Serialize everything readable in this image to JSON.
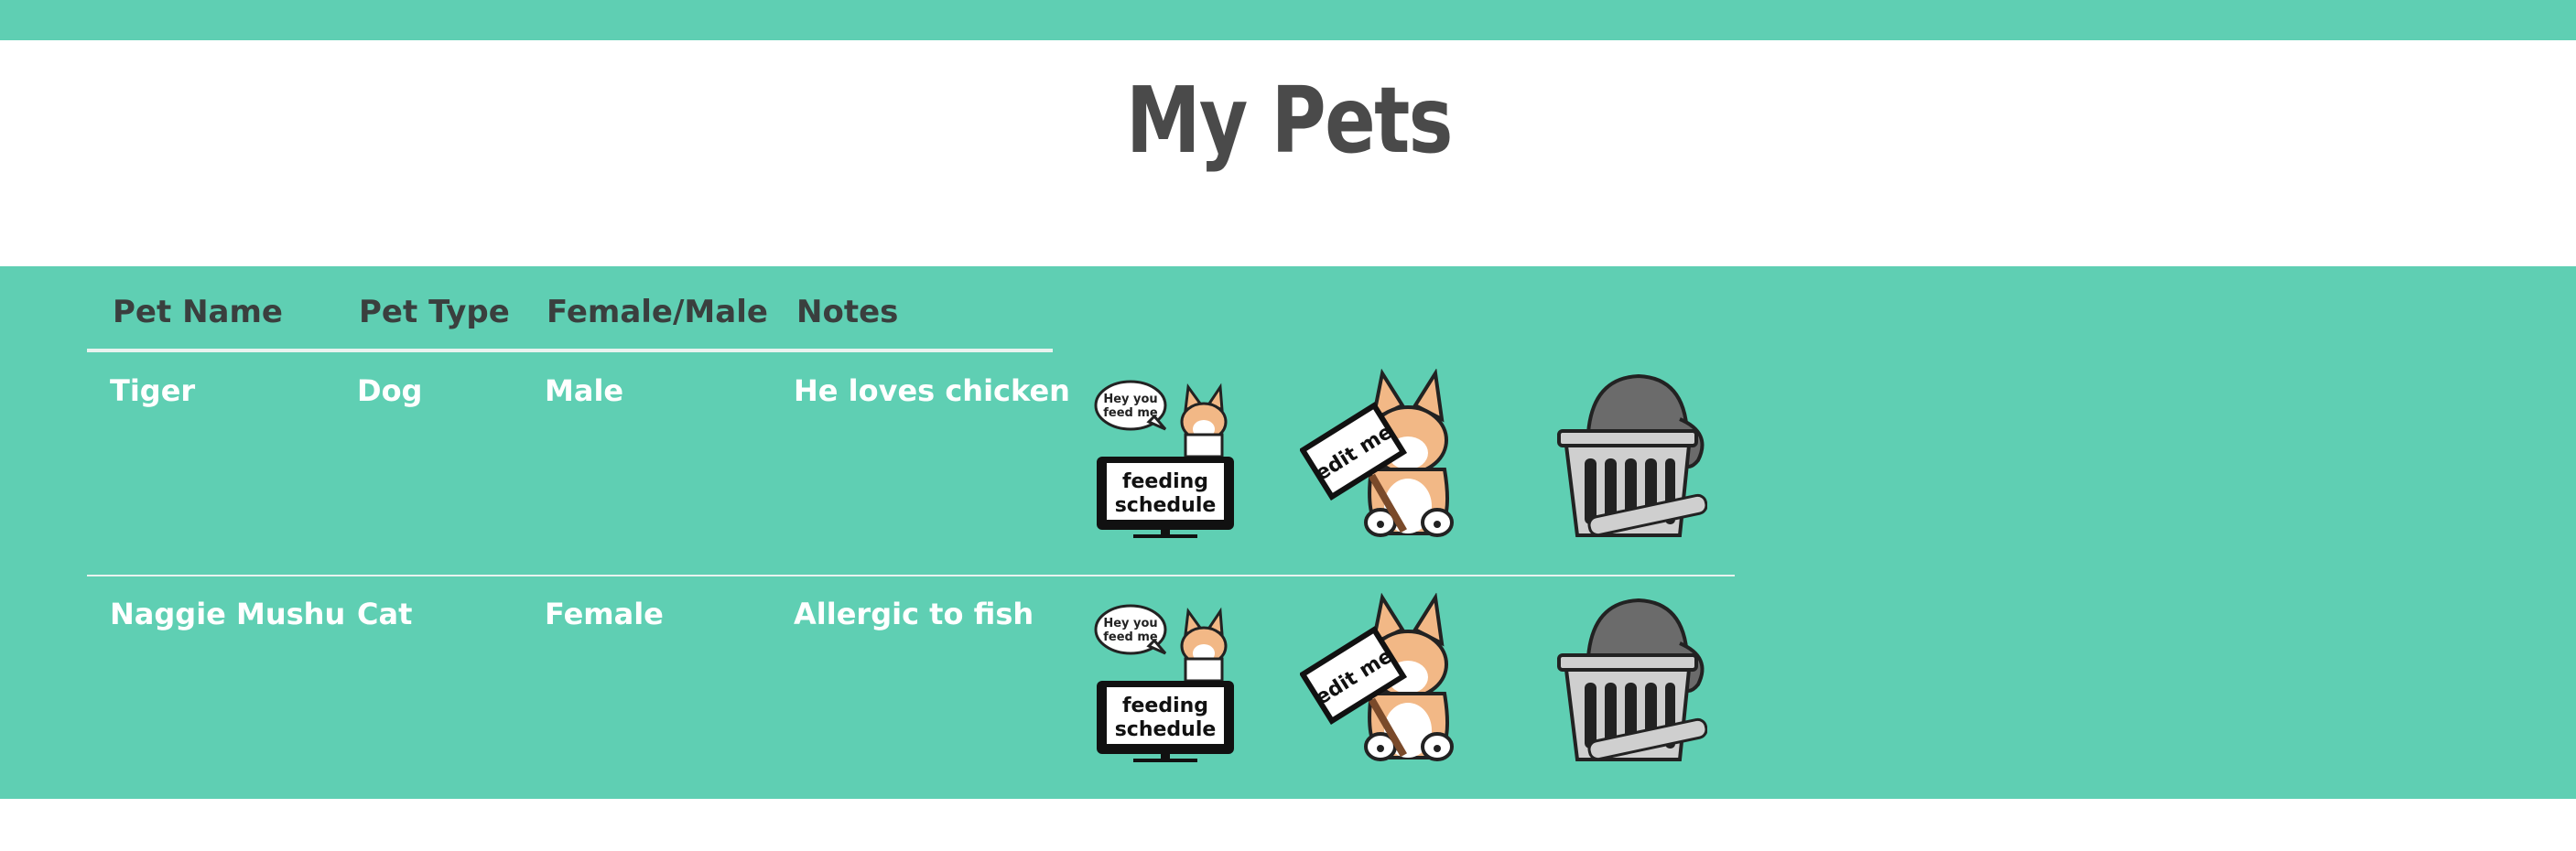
{
  "colors": {
    "accent": "#5fcfb3",
    "title": "#4a4a4a",
    "header_text": "#3a3f3e",
    "cell_text": "#ffffff"
  },
  "page": {
    "title": "My Pets"
  },
  "table": {
    "headers": [
      "Pet Name",
      "Pet Type",
      "Female/Male",
      "Notes"
    ],
    "rows": [
      {
        "name": "Tiger",
        "type": "Dog",
        "sex": "Male",
        "notes": "He loves chicken"
      },
      {
        "name": "Naggie Mushu",
        "type": "Cat",
        "sex": "Female",
        "notes": "Allergic to fish"
      }
    ]
  },
  "actions": {
    "feeding": {
      "bubble_line1": "Hey you",
      "bubble_line2": "feed me",
      "screen_line1": "feeding",
      "screen_line2": "schedule",
      "icon": "corgi-feeding-schedule-icon"
    },
    "edit": {
      "sign_text": "edit me",
      "icon": "corgi-edit-sign-icon"
    },
    "delete": {
      "icon": "trash-can-cat-icon"
    }
  }
}
